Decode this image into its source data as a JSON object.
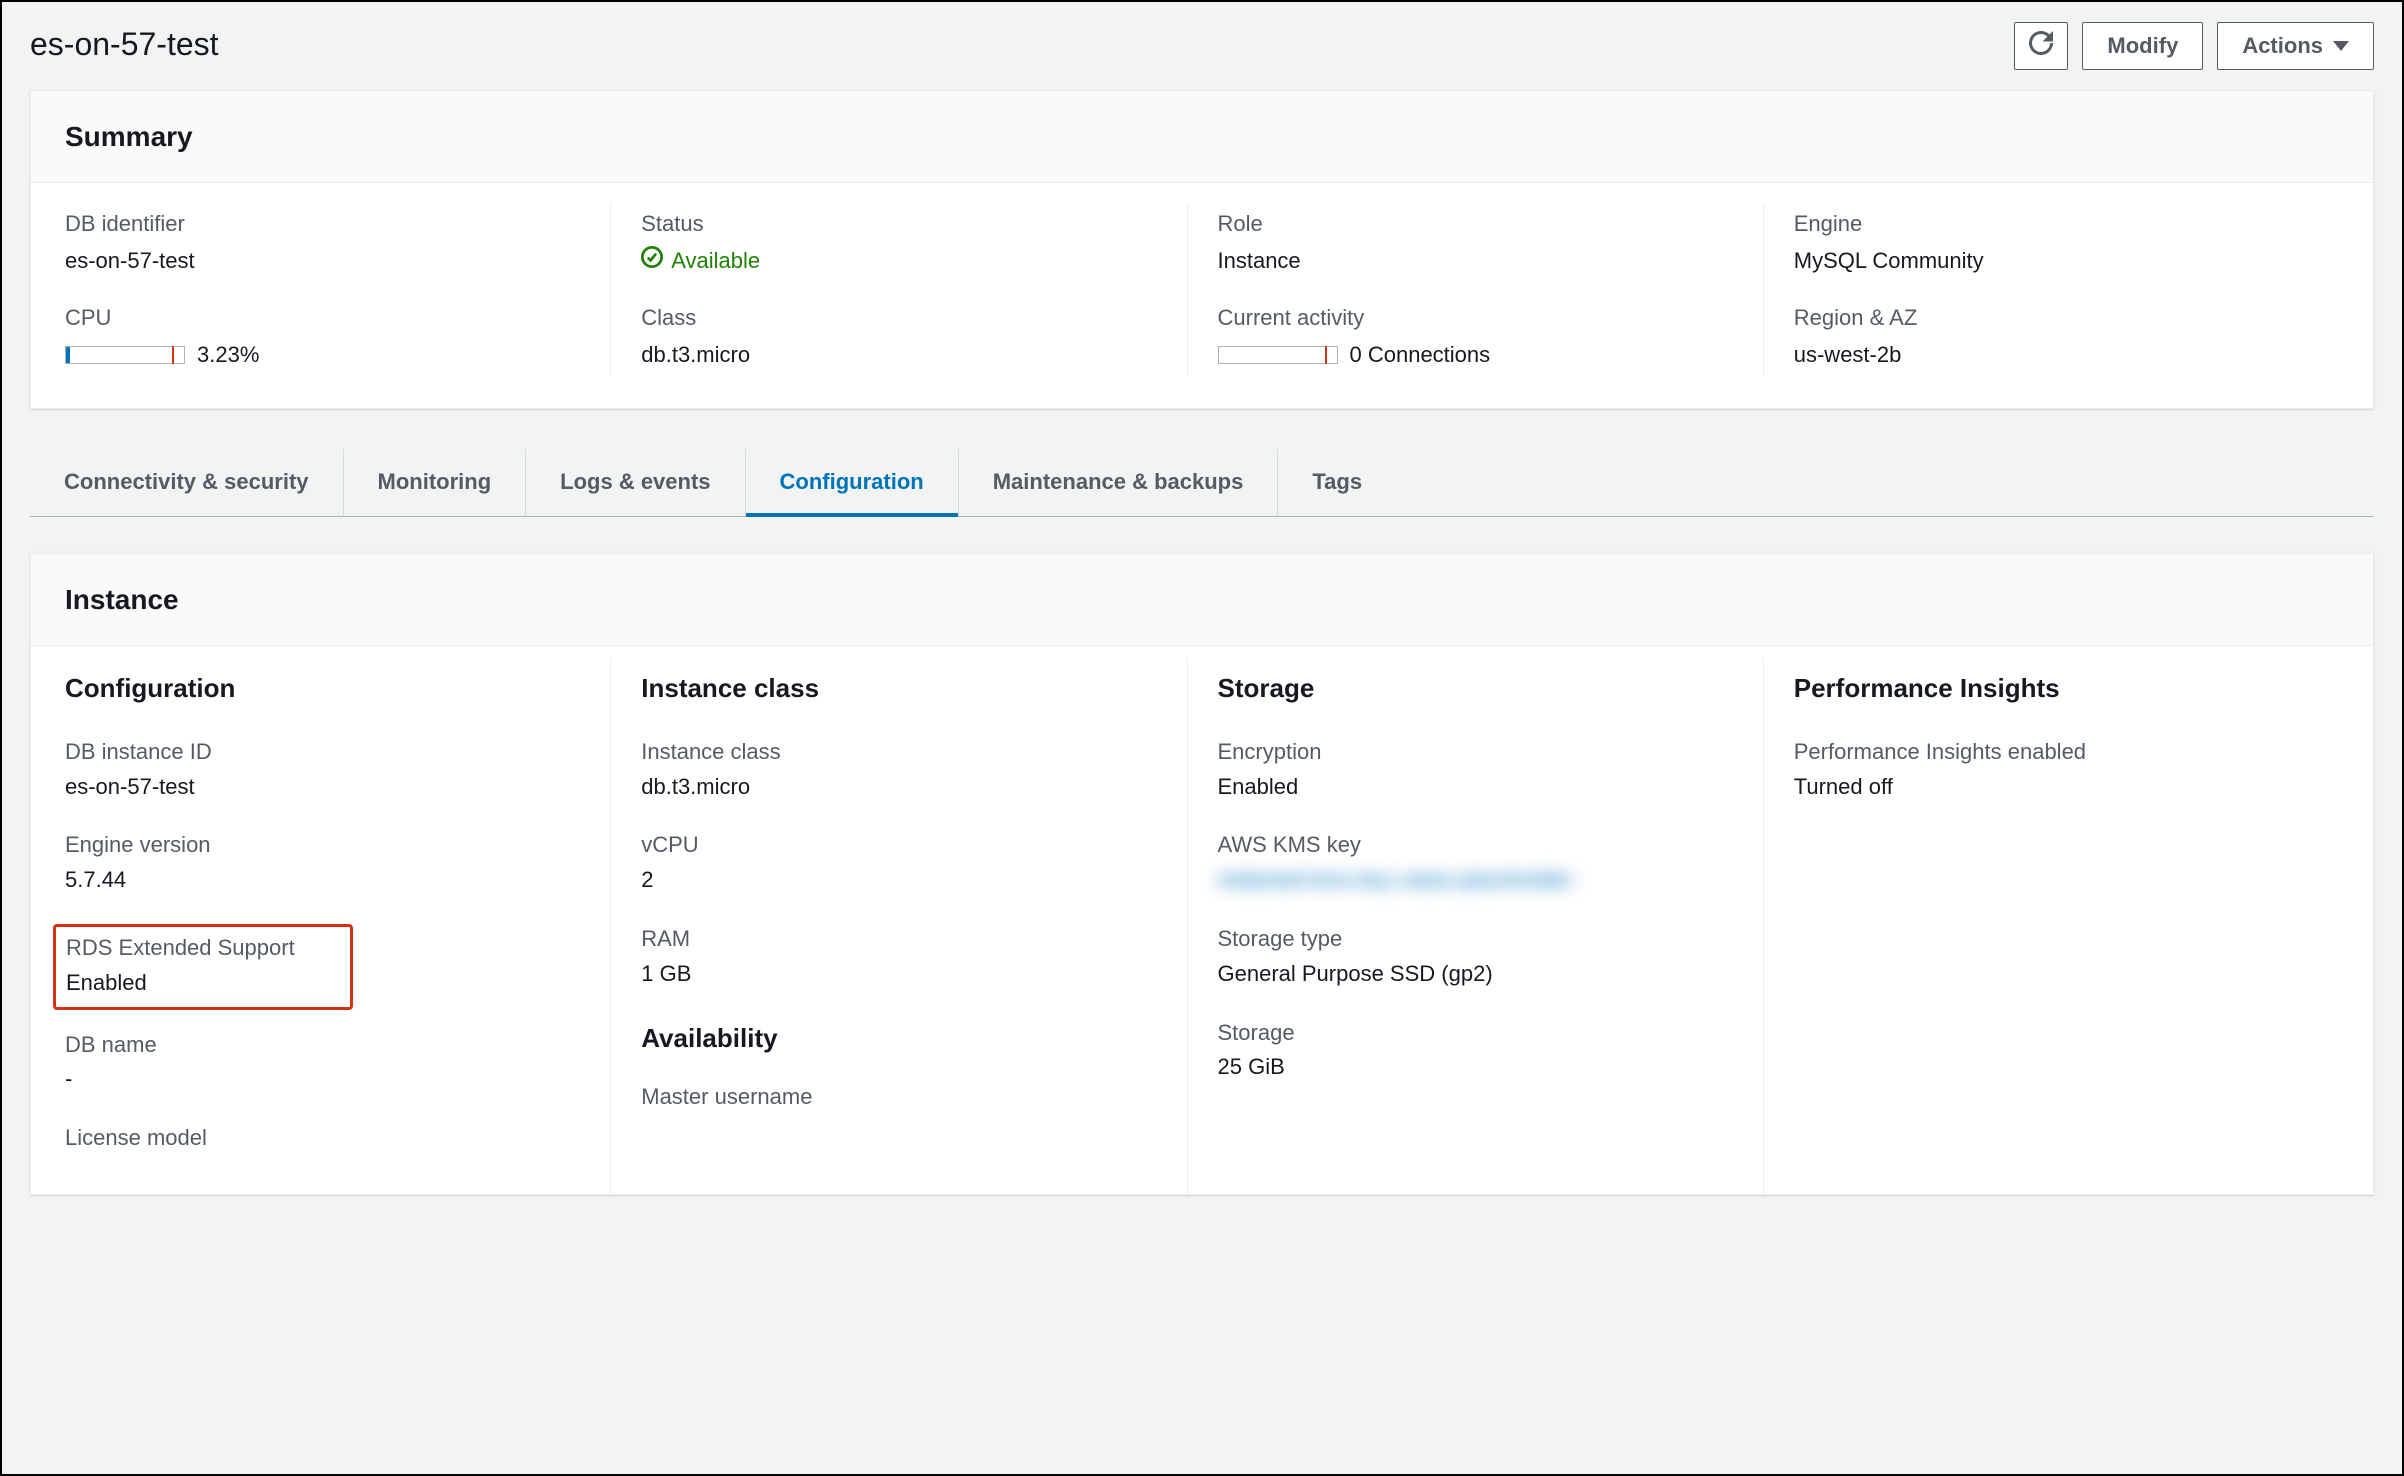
{
  "header": {
    "title": "es-on-57-test",
    "buttons": {
      "modify": "Modify",
      "actions": "Actions"
    }
  },
  "summary": {
    "heading": "Summary",
    "col1": {
      "db_identifier_label": "DB identifier",
      "db_identifier_value": "es-on-57-test",
      "cpu_label": "CPU",
      "cpu_percent_text": "3.23%",
      "cpu_percent": 3.23
    },
    "col2": {
      "status_label": "Status",
      "status_value": "Available",
      "class_label": "Class",
      "class_value": "db.t3.micro"
    },
    "col3": {
      "role_label": "Role",
      "role_value": "Instance",
      "activity_label": "Current activity",
      "activity_value": "0 Connections",
      "activity_count": 0
    },
    "col4": {
      "engine_label": "Engine",
      "engine_value": "MySQL Community",
      "region_label": "Region & AZ",
      "region_value": "us-west-2b"
    }
  },
  "tabs": [
    {
      "label": "Connectivity & security",
      "active": false
    },
    {
      "label": "Monitoring",
      "active": false
    },
    {
      "label": "Logs & events",
      "active": false
    },
    {
      "label": "Configuration",
      "active": true
    },
    {
      "label": "Maintenance & backups",
      "active": false
    },
    {
      "label": "Tags",
      "active": false
    }
  ],
  "instance": {
    "heading": "Instance",
    "configuration": {
      "title": "Configuration",
      "db_instance_id_label": "DB instance ID",
      "db_instance_id_value": "es-on-57-test",
      "engine_version_label": "Engine version",
      "engine_version_value": "5.7.44",
      "rds_ext_label": "RDS Extended Support",
      "rds_ext_value": "Enabled",
      "db_name_label": "DB name",
      "db_name_value": "-",
      "license_label": "License model"
    },
    "instance_class": {
      "title": "Instance class",
      "class_label": "Instance class",
      "class_value": "db.t3.micro",
      "vcpu_label": "vCPU",
      "vcpu_value": "2",
      "ram_label": "RAM",
      "ram_value": "1 GB",
      "availability_title": "Availability",
      "master_user_label": "Master username"
    },
    "storage": {
      "title": "Storage",
      "encryption_label": "Encryption",
      "encryption_value": "Enabled",
      "kms_label": "AWS KMS key",
      "kms_value_redacted": "redacted-kms-key-value-placeholder",
      "storage_type_label": "Storage type",
      "storage_type_value": "General Purpose SSD (gp2)",
      "storage_label": "Storage",
      "storage_value": "25 GiB"
    },
    "perf": {
      "title": "Performance Insights",
      "pi_label": "Performance Insights enabled",
      "pi_value": "Turned off"
    }
  }
}
